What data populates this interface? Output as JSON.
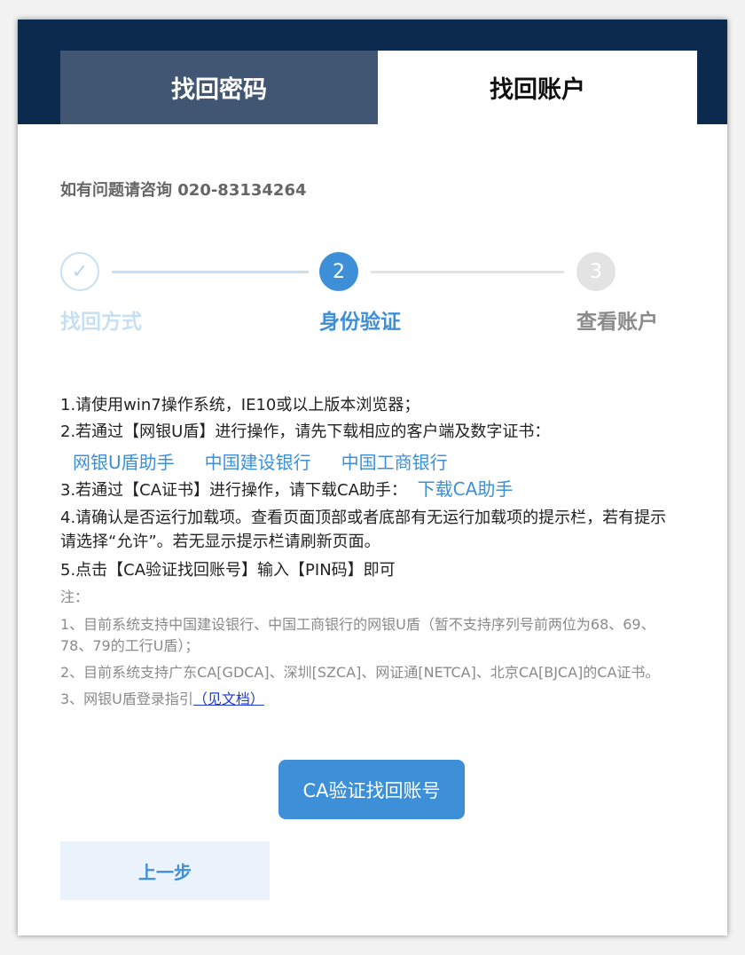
{
  "tabs": {
    "find_password": "找回密码",
    "find_account": "找回账户"
  },
  "contact": "如有问题请咨询 020-83134264",
  "steps": {
    "step1": {
      "number": "✓",
      "label": "找回方式"
    },
    "step2": {
      "number": "2",
      "label": "身份验证"
    },
    "step3": {
      "number": "3",
      "label": "查看账户"
    }
  },
  "instructions": {
    "line1": "1.请使用win7操作系统，IE10或以上版本浏览器；",
    "line2": "2.若通过【网银U盾】进行操作，请先下载相应的客户端及数字证书：",
    "links": {
      "ukey_helper": "网银U盾助手",
      "ccb": "中国建设银行",
      "icbc": "中国工商银行"
    },
    "line3": "3.若通过【CA证书】进行操作，请下载CA助手：",
    "download_ca": "下载CA助手",
    "line4": "4.请确认是否运行加载项。查看页面顶部或者底部有无运行加载项的提示栏，若有提示请选择“允许”。若无显示提示栏请刷新页面。",
    "line5": "5.点击【CA验证找回账号】输入【PIN码】即可"
  },
  "notes": {
    "title": "注：",
    "note1": "1、目前系统支持中国建设银行、中国工商银行的网银U盾（暂不支持序列号前两位为68、69、78、79的工行U盾）；",
    "note2": "2、目前系统支持广东CA[GDCA]、深圳[SZCA]、网证通[NETCA]、北京CA[BJCA]的CA证书。",
    "note3_prefix": "3、网银U盾登录指引",
    "note3_link": "（见文档）"
  },
  "buttons": {
    "ca_verify": "CA验证找回账号",
    "previous": "上一步"
  },
  "colors": {
    "header_bg": "#0c2a4e",
    "accent": "#3d8fd8",
    "inactive_tab": "#415673"
  }
}
